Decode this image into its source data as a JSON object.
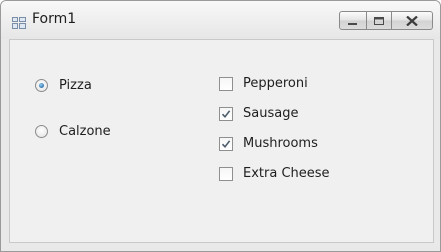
{
  "window": {
    "title": "Form1",
    "icons": {
      "app": "form-icon",
      "minimize": "minimize-icon",
      "maximize": "maximize-icon",
      "close": "close-icon"
    }
  },
  "radios": [
    {
      "label": "Pizza",
      "checked": true
    },
    {
      "label": "Calzone",
      "checked": false
    }
  ],
  "checkboxes": [
    {
      "label": "Pepperoni",
      "checked": false
    },
    {
      "label": "Sausage",
      "checked": true
    },
    {
      "label": "Mushrooms",
      "checked": true
    },
    {
      "label": "Extra Cheese",
      "checked": false
    }
  ],
  "colors": {
    "client_bg": "#f0f0f0",
    "frame_bg": "#e9e9e9",
    "radio_accent": "#3d7fb8"
  }
}
